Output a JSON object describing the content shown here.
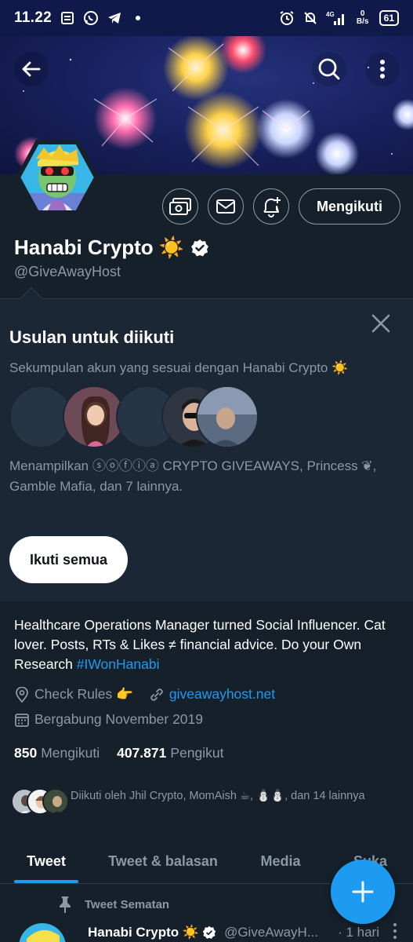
{
  "status_bar": {
    "time": "11.22",
    "network": "4G",
    "speed": "0 B/s",
    "battery": "61"
  },
  "profile": {
    "name": "Hanabi Crypto ☀️",
    "handle": "@GiveAwayHost",
    "follow_button": "Mengikuti",
    "bio_text": "Healthcare Operations Manager turned Social Influencer. Cat lover. Posts, RTs & Likes ≠ financial advice. Do your Own Research ",
    "bio_hashtag": "#IWonHanabi",
    "rules": "Check Rules 👉",
    "website": "giveawayhost.net",
    "joined": "Bergabung November 2019",
    "following_count": "850",
    "following_label": "Mengikuti",
    "followers_count": "407.871",
    "followers_label": "Pengikut",
    "followed_by": "Diikuti oleh Jhil Crypto, MomAish ☕, ⛄⛄, dan 14 lainnya"
  },
  "suggestions": {
    "title": "Usulan untuk diikuti",
    "subtitle": "Sekumpulan akun yang sesuai dengan Hanabi Crypto ☀️",
    "description": "Menampilkan ⓢⓞⓕⓘⓐ CRYPTO GIVEAWAYS, Princess ❦, Gamble Mafia, dan 7 lainnya.",
    "follow_all": "Ikuti semua"
  },
  "tabs": [
    "Tweet",
    "Tweet & balasan",
    "Media",
    "Suka"
  ],
  "pinned": {
    "label": "Tweet Sematan",
    "name": "Hanabi Crypto ☀️",
    "handle": "@GiveAwayH...",
    "time": "· 1 hari"
  },
  "colors": {
    "accent": "#1d9bf0",
    "background": "#15202b",
    "panel": "#1b2735",
    "muted": "#8b98a5"
  },
  "icons": {
    "back": "arrow-left-icon",
    "search": "search-icon",
    "more": "more-vertical-icon",
    "tip": "money-icon",
    "message": "mail-icon",
    "notify": "bell-plus-icon",
    "verified": "verified-badge-icon",
    "close": "close-icon",
    "location": "location-icon",
    "link": "link-icon",
    "calendar": "calendar-icon",
    "pin": "pin-icon",
    "compose": "plus-icon"
  }
}
